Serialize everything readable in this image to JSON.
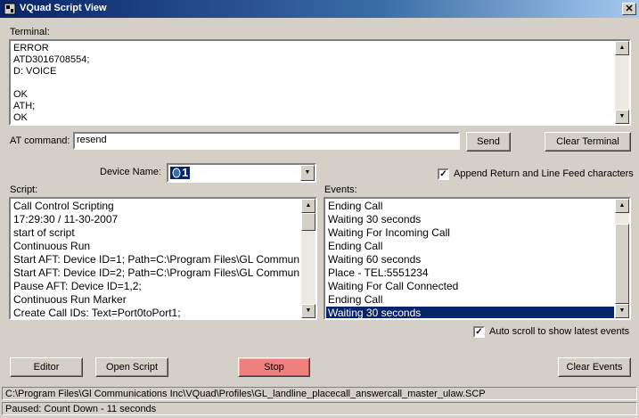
{
  "window": {
    "title": "VQuad Script View",
    "close_glyph": "✕"
  },
  "terminal": {
    "label": "Terminal:",
    "lines": [
      "ERROR",
      "ATD3016708554;",
      "D: VOICE",
      "",
      "OK",
      "ATH;",
      "OK"
    ]
  },
  "at_command": {
    "label": "AT command:",
    "value": "resend"
  },
  "buttons": {
    "send": "Send",
    "clear_terminal": "Clear Terminal",
    "editor": "Editor",
    "open_script": "Open Script",
    "stop": "Stop",
    "clear_events": "Clear Events"
  },
  "device": {
    "label": "Device Name:",
    "value": "1"
  },
  "append_crlf": {
    "label": "Append Return and Line Feed characters",
    "checked": true
  },
  "script": {
    "label": "Script:",
    "lines": [
      "Call Control Scripting",
      "17:29:30 / 11-30-2007",
      "start of script",
      "Continuous Run",
      "Start AFT: Device ID=1; Path=C:\\Program Files\\GL Commun",
      "Start AFT: Device ID=2; Path=C:\\Program Files\\GL Commun",
      "Pause AFT: Device ID=1,2;",
      "Continuous Run Marker",
      "Create Call IDs: Text=Port0toPort1;"
    ]
  },
  "events": {
    "label": "Events:",
    "lines": [
      "Ending Call",
      "Waiting 30 seconds",
      "Waiting For Incoming Call",
      "Ending Call",
      "Waiting 60 seconds",
      "Place - TEL:5551234",
      "Waiting For Call Connected",
      "Ending Call",
      "Waiting 30 seconds"
    ],
    "selected_index": 8
  },
  "auto_scroll": {
    "label": "Auto scroll to show latest events",
    "checked": true
  },
  "status": {
    "path": "C:\\Program Files\\Gl Communications Inc\\VQuad\\Profiles\\GL_landline_placecall_answercall_master_ulaw.SCP",
    "state": "Paused:  Count Down - 11 seconds"
  },
  "colors": {
    "stop_button": "#f08080",
    "selection": "#0a246a",
    "title_start": "#0a246a"
  },
  "icons": {
    "app": "app-icon",
    "device": "device-icon",
    "check": "check-icon",
    "arrow_up": "scroll-up-icon",
    "arrow_down": "scroll-down-icon"
  }
}
